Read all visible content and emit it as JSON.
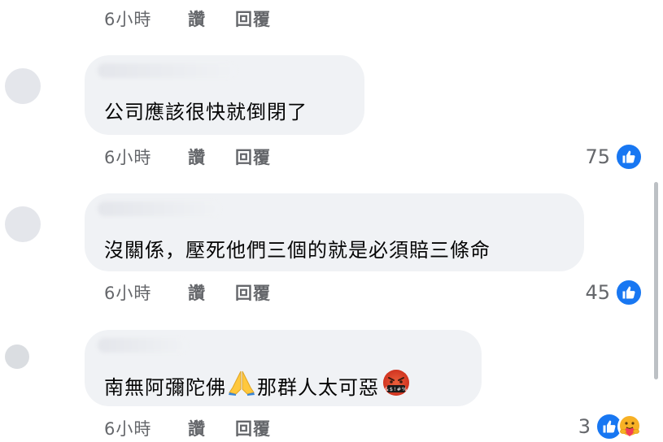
{
  "comments": [
    {
      "meta": {
        "time": "6小時",
        "like": "讚",
        "reply": "回覆"
      }
    },
    {
      "text": "公司應該很快就倒閉了",
      "meta": {
        "time": "6小時",
        "like": "讚",
        "reply": "回覆"
      },
      "reactions": {
        "count": "75",
        "icons": [
          "like-icon"
        ]
      }
    },
    {
      "text": "沒關係，壓死他們三個的就是必須賠三條命",
      "meta": {
        "time": "6小時",
        "like": "讚",
        "reply": "回覆"
      },
      "reactions": {
        "count": "45",
        "icons": [
          "like-icon"
        ]
      }
    },
    {
      "text_before": "南無阿彌陀佛",
      "emoji1": "folded-hands-emoji",
      "text_middle": "那群人太可惡",
      "emoji2": "cursing-face-emoji",
      "meta": {
        "time": "6小時",
        "like": "讚",
        "reply": "回覆"
      },
      "reactions": {
        "count": "3",
        "icons": [
          "like-icon",
          "care-icon"
        ]
      }
    }
  ],
  "colors": {
    "like_blue": "#1877f2",
    "bubble_bg": "#f0f2f5",
    "meta_gray": "#65676b"
  }
}
